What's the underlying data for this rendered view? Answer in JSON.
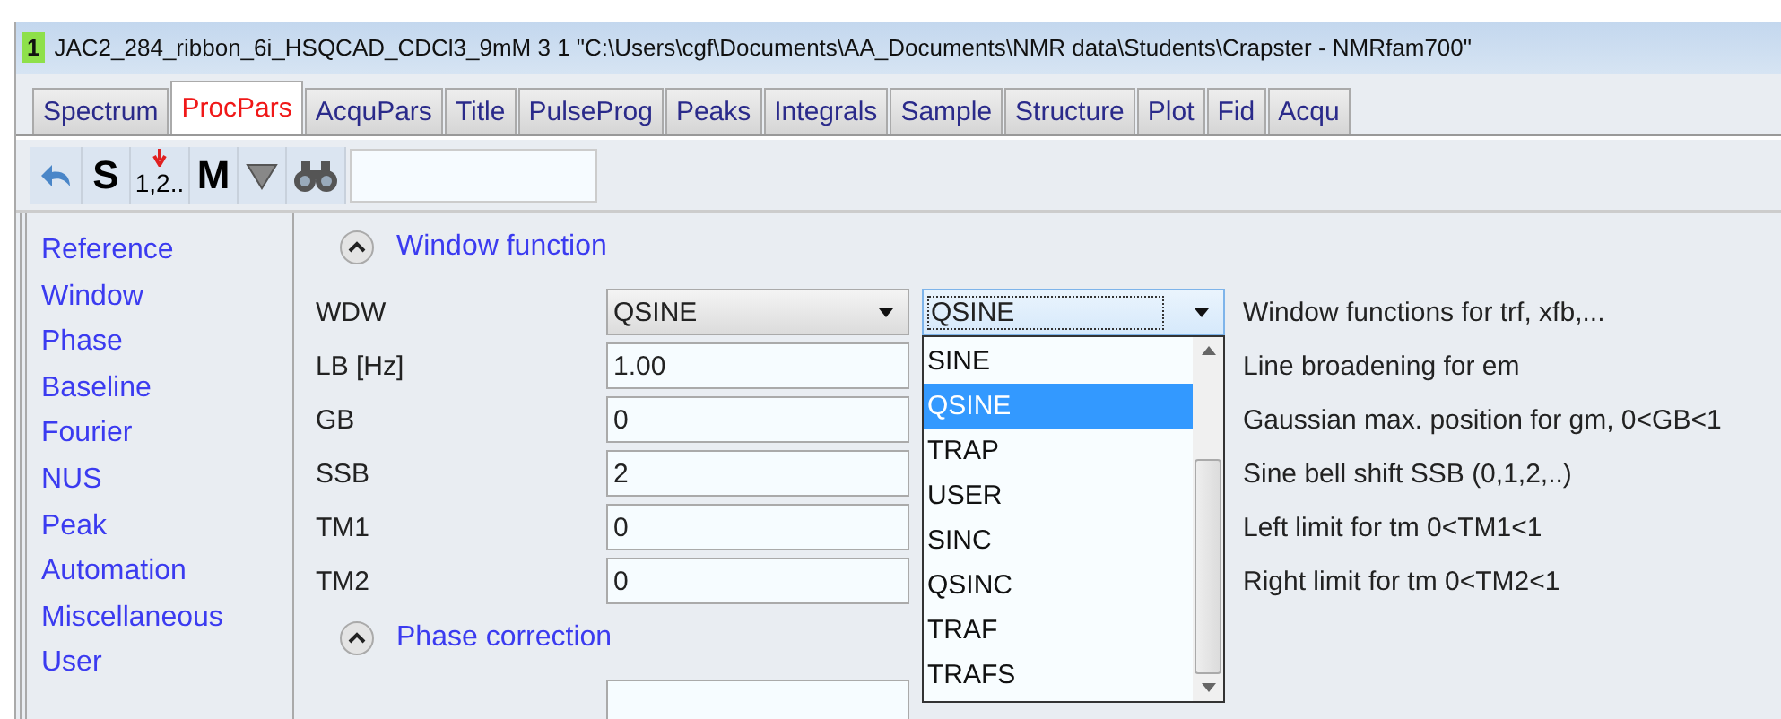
{
  "window": {
    "badge": "1",
    "title": "JAC2_284_ribbon_6i_HSQCAD_CDCl3_9mM  3  1  \"C:\\Users\\cgf\\Documents\\AA_Documents\\NMR data\\Students\\Crapster - NMRfam700\""
  },
  "tabs": [
    {
      "label": "Spectrum",
      "selected": false
    },
    {
      "label": "ProcPars",
      "selected": true
    },
    {
      "label": "AcquPars",
      "selected": false
    },
    {
      "label": "Title",
      "selected": false
    },
    {
      "label": "PulseProg",
      "selected": false
    },
    {
      "label": "Peaks",
      "selected": false
    },
    {
      "label": "Integrals",
      "selected": false
    },
    {
      "label": "Sample",
      "selected": false
    },
    {
      "label": "Structure",
      "selected": false
    },
    {
      "label": "Plot",
      "selected": false
    },
    {
      "label": "Fid",
      "selected": false
    },
    {
      "label": "Acqu",
      "selected": false
    }
  ],
  "toolbar": [
    {
      "kind": "undo"
    },
    {
      "kind": "letter",
      "label": "S"
    },
    {
      "kind": "number",
      "label": "1,2.."
    },
    {
      "kind": "letter",
      "label": "M"
    },
    {
      "kind": "triangle"
    },
    {
      "kind": "binoculars"
    }
  ],
  "sidebar": {
    "items": [
      "Reference",
      "Window",
      "Phase",
      "Baseline",
      "Fourier",
      "NUS",
      "Peak",
      "Automation",
      "Miscellaneous",
      "User"
    ]
  },
  "sections": [
    {
      "title": "Window function",
      "expanded": true,
      "rows": [
        {
          "name": "WDW",
          "kind": "dropdown",
          "value": "QSINE",
          "description": "Window functions for trf, xfb,..."
        },
        {
          "name": "LB [Hz]",
          "kind": "text",
          "value": "1.00",
          "description": "Line broadening for em"
        },
        {
          "name": "GB",
          "kind": "text",
          "value": "0",
          "description": "Gaussian max. position for gm, 0<GB<1"
        },
        {
          "name": "SSB",
          "kind": "text",
          "value": "2",
          "description": "Sine bell shift SSB (0,1,2,..)"
        },
        {
          "name": "TM1",
          "kind": "text",
          "value": "0",
          "description": "Left limit for tm 0<TM1<1"
        },
        {
          "name": "TM2",
          "kind": "text",
          "value": "0",
          "description": "Right limit for tm 0<TM2<1"
        }
      ]
    },
    {
      "title": "Phase correction",
      "expanded": true,
      "rows": [
        {
          "kind": "text",
          "value": ""
        }
      ]
    }
  ],
  "dropdown": {
    "value": "QSINE",
    "options": [
      {
        "label": "SINE",
        "selected": false
      },
      {
        "label": "QSINE",
        "selected": true
      },
      {
        "label": "TRAP",
        "selected": false
      },
      {
        "label": "USER",
        "selected": false
      },
      {
        "label": "SINC",
        "selected": false
      },
      {
        "label": "QSINC",
        "selected": false
      },
      {
        "label": "TRAF",
        "selected": false
      },
      {
        "label": "TRAFS",
        "selected": false
      }
    ]
  }
}
